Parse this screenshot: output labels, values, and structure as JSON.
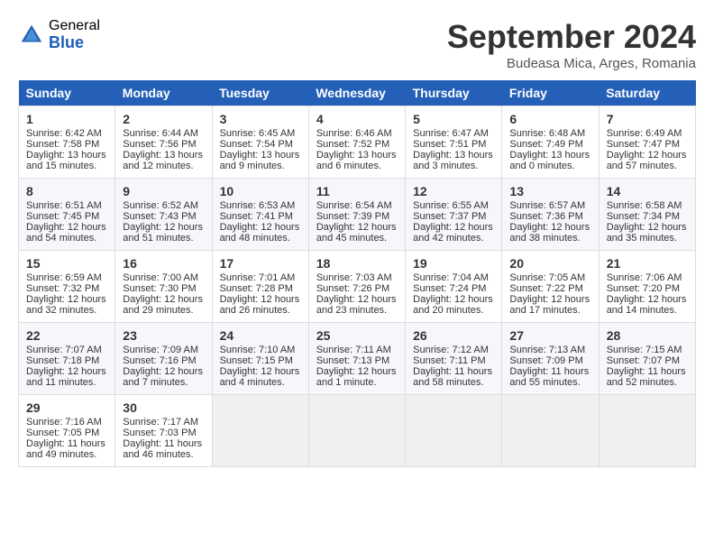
{
  "header": {
    "logo_general": "General",
    "logo_blue": "Blue",
    "title": "September 2024",
    "location": "Budeasa Mica, Arges, Romania"
  },
  "days_of_week": [
    "Sunday",
    "Monday",
    "Tuesday",
    "Wednesday",
    "Thursday",
    "Friday",
    "Saturday"
  ],
  "weeks": [
    [
      {
        "day": "1",
        "lines": [
          "Sunrise: 6:42 AM",
          "Sunset: 7:58 PM",
          "Daylight: 13 hours",
          "and 15 minutes."
        ]
      },
      {
        "day": "2",
        "lines": [
          "Sunrise: 6:44 AM",
          "Sunset: 7:56 PM",
          "Daylight: 13 hours",
          "and 12 minutes."
        ]
      },
      {
        "day": "3",
        "lines": [
          "Sunrise: 6:45 AM",
          "Sunset: 7:54 PM",
          "Daylight: 13 hours",
          "and 9 minutes."
        ]
      },
      {
        "day": "4",
        "lines": [
          "Sunrise: 6:46 AM",
          "Sunset: 7:52 PM",
          "Daylight: 13 hours",
          "and 6 minutes."
        ]
      },
      {
        "day": "5",
        "lines": [
          "Sunrise: 6:47 AM",
          "Sunset: 7:51 PM",
          "Daylight: 13 hours",
          "and 3 minutes."
        ]
      },
      {
        "day": "6",
        "lines": [
          "Sunrise: 6:48 AM",
          "Sunset: 7:49 PM",
          "Daylight: 13 hours",
          "and 0 minutes."
        ]
      },
      {
        "day": "7",
        "lines": [
          "Sunrise: 6:49 AM",
          "Sunset: 7:47 PM",
          "Daylight: 12 hours",
          "and 57 minutes."
        ]
      }
    ],
    [
      {
        "day": "8",
        "lines": [
          "Sunrise: 6:51 AM",
          "Sunset: 7:45 PM",
          "Daylight: 12 hours",
          "and 54 minutes."
        ]
      },
      {
        "day": "9",
        "lines": [
          "Sunrise: 6:52 AM",
          "Sunset: 7:43 PM",
          "Daylight: 12 hours",
          "and 51 minutes."
        ]
      },
      {
        "day": "10",
        "lines": [
          "Sunrise: 6:53 AM",
          "Sunset: 7:41 PM",
          "Daylight: 12 hours",
          "and 48 minutes."
        ]
      },
      {
        "day": "11",
        "lines": [
          "Sunrise: 6:54 AM",
          "Sunset: 7:39 PM",
          "Daylight: 12 hours",
          "and 45 minutes."
        ]
      },
      {
        "day": "12",
        "lines": [
          "Sunrise: 6:55 AM",
          "Sunset: 7:37 PM",
          "Daylight: 12 hours",
          "and 42 minutes."
        ]
      },
      {
        "day": "13",
        "lines": [
          "Sunrise: 6:57 AM",
          "Sunset: 7:36 PM",
          "Daylight: 12 hours",
          "and 38 minutes."
        ]
      },
      {
        "day": "14",
        "lines": [
          "Sunrise: 6:58 AM",
          "Sunset: 7:34 PM",
          "Daylight: 12 hours",
          "and 35 minutes."
        ]
      }
    ],
    [
      {
        "day": "15",
        "lines": [
          "Sunrise: 6:59 AM",
          "Sunset: 7:32 PM",
          "Daylight: 12 hours",
          "and 32 minutes."
        ]
      },
      {
        "day": "16",
        "lines": [
          "Sunrise: 7:00 AM",
          "Sunset: 7:30 PM",
          "Daylight: 12 hours",
          "and 29 minutes."
        ]
      },
      {
        "day": "17",
        "lines": [
          "Sunrise: 7:01 AM",
          "Sunset: 7:28 PM",
          "Daylight: 12 hours",
          "and 26 minutes."
        ]
      },
      {
        "day": "18",
        "lines": [
          "Sunrise: 7:03 AM",
          "Sunset: 7:26 PM",
          "Daylight: 12 hours",
          "and 23 minutes."
        ]
      },
      {
        "day": "19",
        "lines": [
          "Sunrise: 7:04 AM",
          "Sunset: 7:24 PM",
          "Daylight: 12 hours",
          "and 20 minutes."
        ]
      },
      {
        "day": "20",
        "lines": [
          "Sunrise: 7:05 AM",
          "Sunset: 7:22 PM",
          "Daylight: 12 hours",
          "and 17 minutes."
        ]
      },
      {
        "day": "21",
        "lines": [
          "Sunrise: 7:06 AM",
          "Sunset: 7:20 PM",
          "Daylight: 12 hours",
          "and 14 minutes."
        ]
      }
    ],
    [
      {
        "day": "22",
        "lines": [
          "Sunrise: 7:07 AM",
          "Sunset: 7:18 PM",
          "Daylight: 12 hours",
          "and 11 minutes."
        ]
      },
      {
        "day": "23",
        "lines": [
          "Sunrise: 7:09 AM",
          "Sunset: 7:16 PM",
          "Daylight: 12 hours",
          "and 7 minutes."
        ]
      },
      {
        "day": "24",
        "lines": [
          "Sunrise: 7:10 AM",
          "Sunset: 7:15 PM",
          "Daylight: 12 hours",
          "and 4 minutes."
        ]
      },
      {
        "day": "25",
        "lines": [
          "Sunrise: 7:11 AM",
          "Sunset: 7:13 PM",
          "Daylight: 12 hours",
          "and 1 minute."
        ]
      },
      {
        "day": "26",
        "lines": [
          "Sunrise: 7:12 AM",
          "Sunset: 7:11 PM",
          "Daylight: 11 hours",
          "and 58 minutes."
        ]
      },
      {
        "day": "27",
        "lines": [
          "Sunrise: 7:13 AM",
          "Sunset: 7:09 PM",
          "Daylight: 11 hours",
          "and 55 minutes."
        ]
      },
      {
        "day": "28",
        "lines": [
          "Sunrise: 7:15 AM",
          "Sunset: 7:07 PM",
          "Daylight: 11 hours",
          "and 52 minutes."
        ]
      }
    ],
    [
      {
        "day": "29",
        "lines": [
          "Sunrise: 7:16 AM",
          "Sunset: 7:05 PM",
          "Daylight: 11 hours",
          "and 49 minutes."
        ]
      },
      {
        "day": "30",
        "lines": [
          "Sunrise: 7:17 AM",
          "Sunset: 7:03 PM",
          "Daylight: 11 hours",
          "and 46 minutes."
        ]
      },
      {
        "day": "",
        "lines": []
      },
      {
        "day": "",
        "lines": []
      },
      {
        "day": "",
        "lines": []
      },
      {
        "day": "",
        "lines": []
      },
      {
        "day": "",
        "lines": []
      }
    ]
  ]
}
